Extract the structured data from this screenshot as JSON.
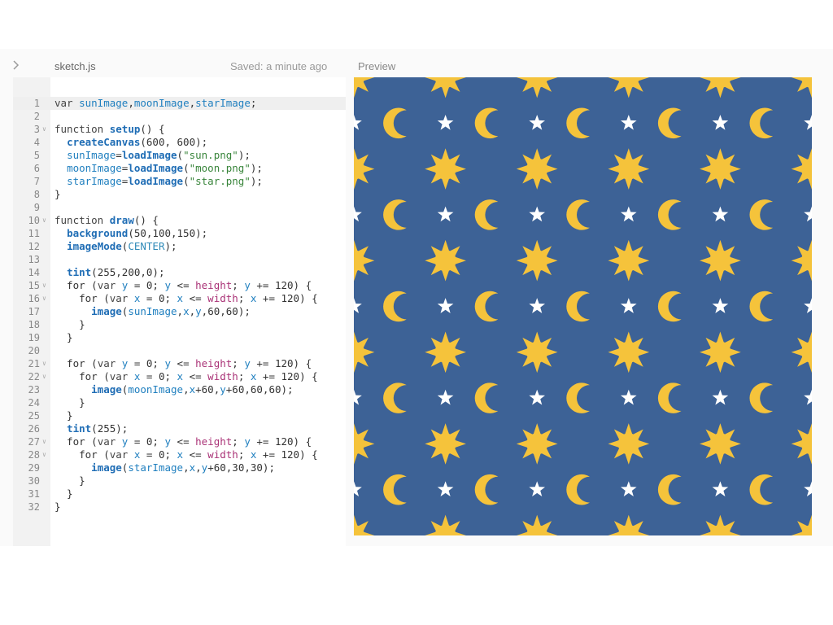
{
  "header": {
    "filename": "sketch.js",
    "saved_status": "Saved: a minute ago",
    "preview_label": "Preview",
    "toggle_icon": "chevron-right-icon"
  },
  "editor": {
    "active_line": 1,
    "lines": [
      "var sunImage,moonImage,starImage;",
      "",
      "function setup() {",
      "  createCanvas(600, 600);",
      "  sunImage=loadImage(\"sun.png\");",
      "  moonImage=loadImage(\"moon.png\");",
      "  starImage=loadImage(\"star.png\");",
      "}",
      "",
      "function draw() {",
      "  background(50,100,150);",
      "  imageMode(CENTER);",
      "",
      "  tint(255,200,0);",
      "  for (var y = 0; y <= height; y += 120) {",
      "    for (var x = 0; x <= width; x += 120) {",
      "      image(sunImage,x,y,60,60);",
      "    }",
      "  }",
      "",
      "  for (var y = 0; y <= height; y += 120) {",
      "    for (var x = 0; x <= width; x += 120) {",
      "      image(moonImage,x+60,y+60,60,60);",
      "    }",
      "  }",
      "  tint(255);",
      "  for (var y = 0; y <= height; y += 120) {",
      "    for (var x = 0; x <= width; x += 120) {",
      "      image(starImage,x,y+60,30,30);",
      "    }",
      "  }",
      "}"
    ],
    "fold_lines": [
      3,
      10,
      15,
      16,
      21,
      22,
      27,
      28
    ]
  },
  "preview": {
    "background_color": "#3d6296",
    "tint_color": "#f5c33b",
    "star_color": "#ffffff",
    "canvas_size": [
      600,
      600
    ],
    "sprites": [
      "sun-icon",
      "moon-icon",
      "star-icon"
    ]
  }
}
